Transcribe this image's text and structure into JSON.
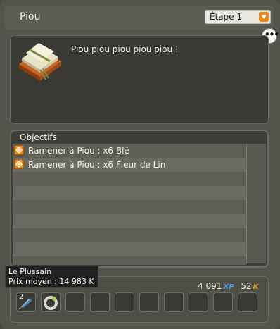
{
  "header": {
    "title": "Piou",
    "step_value": "Étape 1"
  },
  "dialog": {
    "text": "Piou piou piou piou piou !"
  },
  "objectives": {
    "title": "Objectifs",
    "items": [
      "Ramener à Piou : x6 Blé",
      "Ramener à Piou : x6 Fleur de Lin"
    ]
  },
  "rewards": {
    "xp_value": "4 091",
    "xp_unit": "XP",
    "k_value": "52",
    "k_unit": "K",
    "first_item_count": "2"
  },
  "tooltip": {
    "name": "Le Plussain",
    "price": "Prix moyen : 14 983 K"
  },
  "colors": {
    "accent": "#f08a14",
    "xp": "#4aa0e8",
    "kamas": "#f0a020"
  }
}
